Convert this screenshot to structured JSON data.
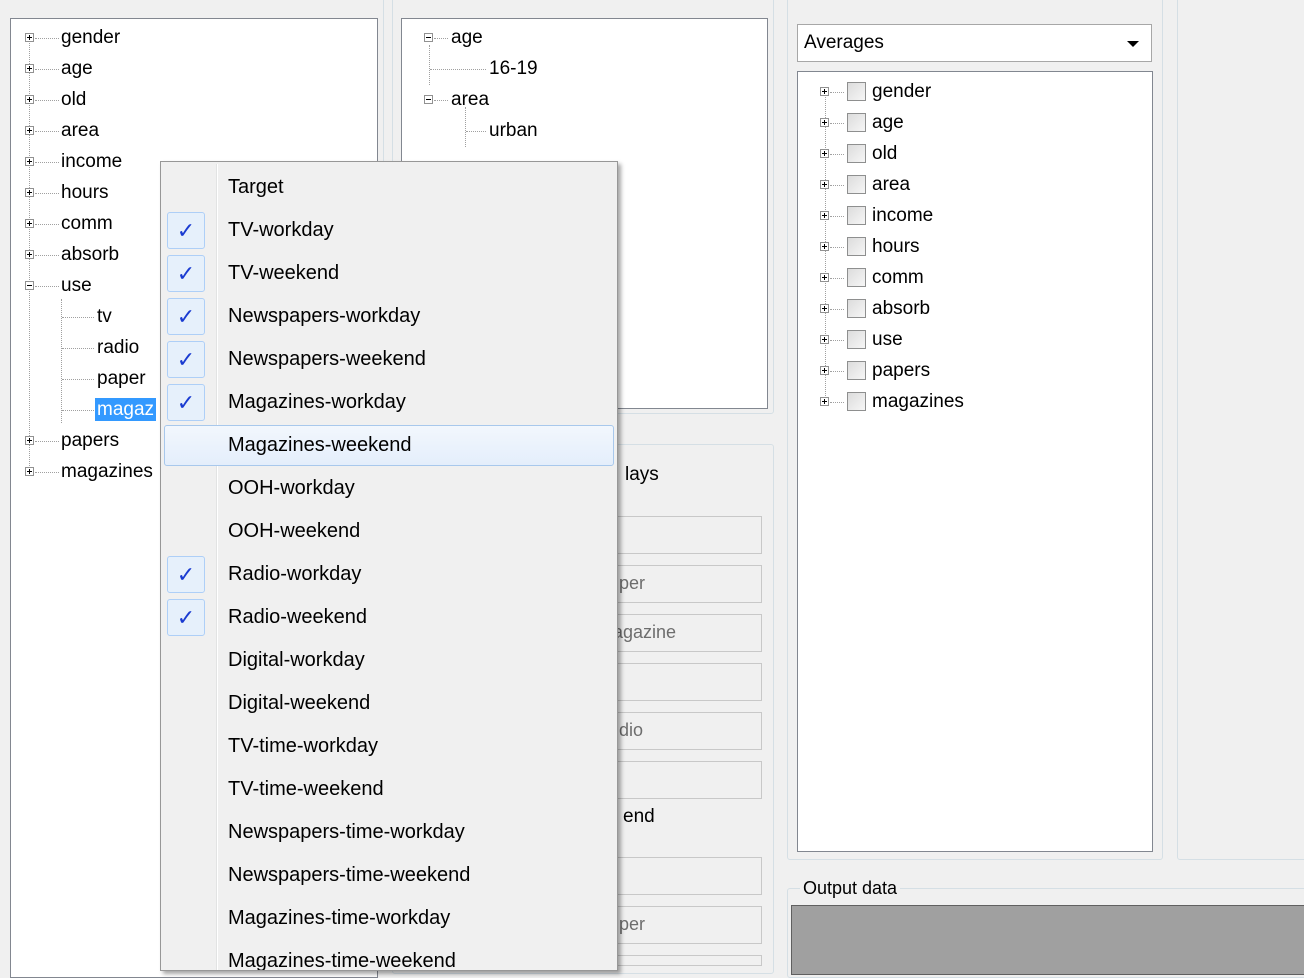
{
  "left_tree": {
    "items": [
      {
        "label": "gender",
        "state": "collapsed"
      },
      {
        "label": "age",
        "state": "collapsed"
      },
      {
        "label": "old",
        "state": "collapsed"
      },
      {
        "label": "area",
        "state": "collapsed"
      },
      {
        "label": "income",
        "state": "collapsed"
      },
      {
        "label": "hours",
        "state": "collapsed"
      },
      {
        "label": "comm",
        "state": "collapsed"
      },
      {
        "label": "absorb",
        "state": "collapsed"
      },
      {
        "label": "use",
        "state": "expanded"
      },
      {
        "label": "papers",
        "state": "collapsed"
      },
      {
        "label": "magazines",
        "state": "collapsed"
      }
    ],
    "use_children": [
      "tv",
      "radio",
      "paper",
      "magaz"
    ],
    "selected_child": "magaz"
  },
  "middle_tree": {
    "nodes": [
      {
        "label": "age",
        "child": "16-19"
      },
      {
        "label": "area",
        "child": "urban"
      }
    ]
  },
  "middle_group": {
    "heading_1_fragment": "lays",
    "heading_2_fragment": "end",
    "textboxes": [
      "",
      "per",
      "agazine",
      "",
      "dio",
      "",
      "",
      "per",
      ""
    ]
  },
  "right_panel": {
    "combo_value": "Averages",
    "tree_items": [
      "gender",
      "age",
      "old",
      "area",
      "income",
      "hours",
      "comm",
      "absorb",
      "use",
      "papers",
      "magazines"
    ]
  },
  "output_group": {
    "legend": "Output data"
  },
  "context_menu": {
    "items": [
      {
        "label": "Target",
        "checked": false,
        "highlighted": false
      },
      {
        "label": "TV-workday",
        "checked": true,
        "highlighted": false
      },
      {
        "label": "TV-weekend",
        "checked": true,
        "highlighted": false
      },
      {
        "label": "Newspapers-workday",
        "checked": true,
        "highlighted": false
      },
      {
        "label": "Newspapers-weekend",
        "checked": true,
        "highlighted": false
      },
      {
        "label": "Magazines-workday",
        "checked": true,
        "highlighted": false
      },
      {
        "label": "Magazines-weekend",
        "checked": false,
        "highlighted": true
      },
      {
        "label": "OOH-workday",
        "checked": false,
        "highlighted": false
      },
      {
        "label": "OOH-weekend",
        "checked": false,
        "highlighted": false
      },
      {
        "label": "Radio-workday",
        "checked": true,
        "highlighted": false
      },
      {
        "label": "Radio-weekend",
        "checked": true,
        "highlighted": false
      },
      {
        "label": "Digital-workday",
        "checked": false,
        "highlighted": false
      },
      {
        "label": "Digital-weekend",
        "checked": false,
        "highlighted": false
      },
      {
        "label": "TV-time-workday",
        "checked": false,
        "highlighted": false
      },
      {
        "label": "TV-time-weekend",
        "checked": false,
        "highlighted": false
      },
      {
        "label": "Newspapers-time-workday",
        "checked": false,
        "highlighted": false
      },
      {
        "label": "Newspapers-time-weekend",
        "checked": false,
        "highlighted": false
      },
      {
        "label": "Magazines-time-workday",
        "checked": false,
        "highlighted": false
      },
      {
        "label": "Magazines-time-weekend",
        "checked": false,
        "highlighted": false
      }
    ],
    "check_glyph": "✓"
  },
  "icons": {
    "tree_expand": "plus-box-icon",
    "tree_collapse": "minus-box-icon",
    "combo_arrow": "chevron-down-icon",
    "menu_check": "checkmark-icon"
  }
}
